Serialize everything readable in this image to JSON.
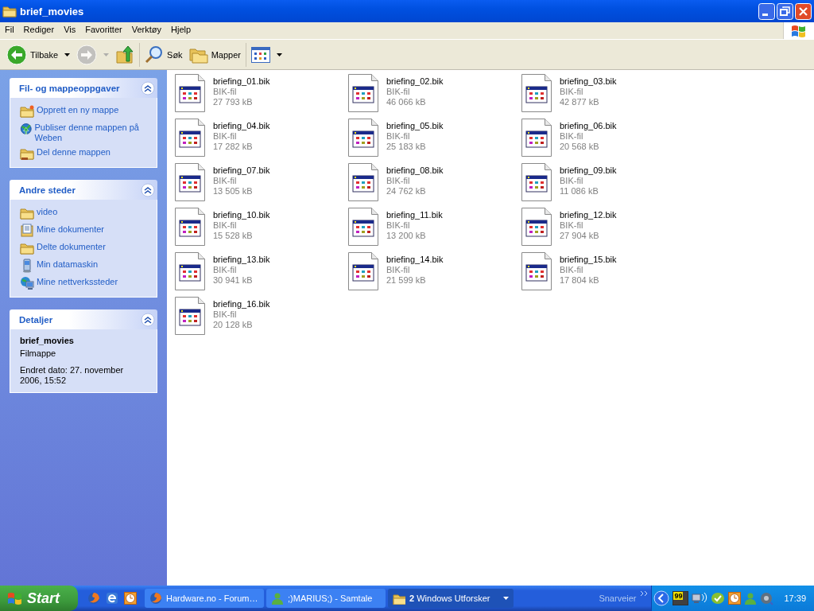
{
  "window": {
    "title": "brief_movies"
  },
  "menu": [
    "Fil",
    "Rediger",
    "Vis",
    "Favoritter",
    "Verktøy",
    "Hjelp"
  ],
  "toolbar": [
    {
      "kind": "back",
      "label": "Tilbake",
      "disabled": false
    },
    {
      "kind": "forward",
      "disabled": true
    },
    {
      "kind": "up",
      "disabled": false
    },
    {
      "kind": "search",
      "label": "Søk",
      "disabled": false
    },
    {
      "kind": "folders",
      "label": "Mapper",
      "disabled": false
    },
    {
      "kind": "views",
      "disabled": false
    }
  ],
  "sidebar": [
    {
      "kind": "links",
      "title": "Fil- og mappeoppgaver",
      "expanded": true,
      "items": [
        {
          "kind": "newfolder",
          "label": "Opprett en ny mappe"
        },
        {
          "kind": "web",
          "label": "Publiser denne mappen på Weben"
        },
        {
          "kind": "share",
          "label": "Del denne mappen"
        }
      ]
    },
    {
      "kind": "links",
      "title": "Andre steder",
      "expanded": true,
      "items": [
        {
          "kind": "folder",
          "label": "video"
        },
        {
          "kind": "documents",
          "label": "Mine dokumenter"
        },
        {
          "kind": "folder",
          "label": "Delte dokumenter"
        },
        {
          "kind": "computer",
          "label": "Min datamaskin"
        },
        {
          "kind": "network",
          "label": "Mine nettverkssteder"
        }
      ]
    },
    {
      "kind": "details",
      "title": "Detaljer",
      "expanded": true,
      "name": "brief_movies",
      "type": "Filmappe",
      "modified": "Endret dato: 27. november 2006, 15:52"
    }
  ],
  "files": [
    {
      "name": "briefing_01.bik",
      "type": "BIK-fil",
      "size": "27 793 kB"
    },
    {
      "name": "briefing_02.bik",
      "type": "BIK-fil",
      "size": "46 066 kB"
    },
    {
      "name": "briefing_03.bik",
      "type": "BIK-fil",
      "size": "42 877 kB"
    },
    {
      "name": "briefing_04.bik",
      "type": "BIK-fil",
      "size": "17 282 kB"
    },
    {
      "name": "briefing_05.bik",
      "type": "BIK-fil",
      "size": "25 183 kB"
    },
    {
      "name": "briefing_06.bik",
      "type": "BIK-fil",
      "size": "20 568 kB"
    },
    {
      "name": "briefing_07.bik",
      "type": "BIK-fil",
      "size": "13 505 kB"
    },
    {
      "name": "briefing_08.bik",
      "type": "BIK-fil",
      "size": "24 762 kB"
    },
    {
      "name": "briefing_09.bik",
      "type": "BIK-fil",
      "size": "11 086 kB"
    },
    {
      "name": "briefing_10.bik",
      "type": "BIK-fil",
      "size": "15 528 kB"
    },
    {
      "name": "briefing_11.bik",
      "type": "BIK-fil",
      "size": "13 200 kB"
    },
    {
      "name": "briefing_12.bik",
      "type": "BIK-fil",
      "size": "27 904 kB"
    },
    {
      "name": "briefing_13.bik",
      "type": "BIK-fil",
      "size": "30 941 kB"
    },
    {
      "name": "briefing_14.bik",
      "type": "BIK-fil",
      "size": "21 599 kB"
    },
    {
      "name": "briefing_15.bik",
      "type": "BIK-fil",
      "size": "17 804 kB"
    },
    {
      "name": "briefing_16.bik",
      "type": "BIK-fil",
      "size": "20 128 kB"
    }
  ],
  "taskbar": {
    "start": "Start",
    "quick_launch": [
      {
        "kind": "browser"
      },
      {
        "kind": "ie"
      },
      {
        "kind": "clock"
      }
    ],
    "buttons": [
      {
        "kind": "browser",
        "label": "Hardware.no - Forum…",
        "selected": false
      },
      {
        "kind": "messenger",
        "label": ";)MARIUS;) - Samtale",
        "selected": false
      },
      {
        "kind": "explorer",
        "count": "2",
        "label": "Windows Utforsker",
        "selected": true
      }
    ],
    "shortcuts": "Snarveier",
    "tray_badge": "99",
    "clock": "17:39"
  }
}
